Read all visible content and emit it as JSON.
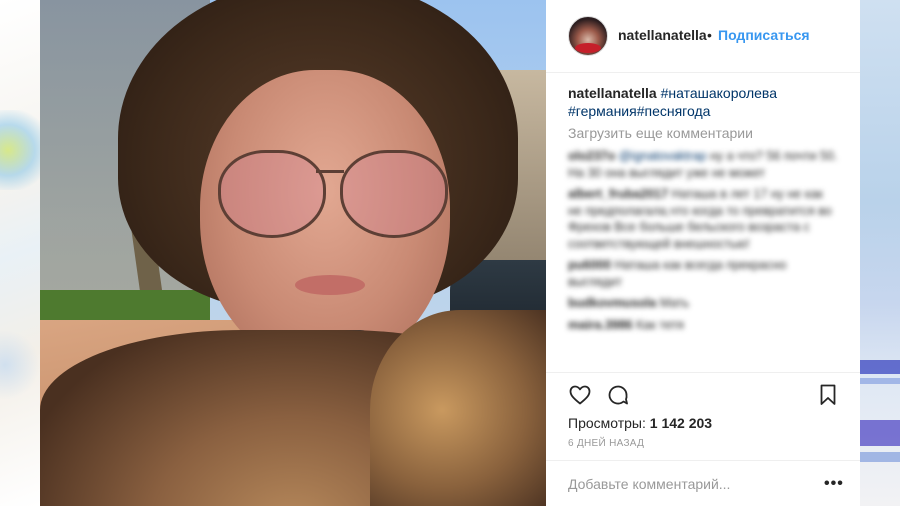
{
  "post": {
    "username": "natellanatella",
    "separator": "•",
    "follow_label": "Подписаться",
    "caption_user": "natellanatella",
    "caption_tags": [
      "#наташакоролева",
      "#германия#песнягода"
    ],
    "load_more": "Загрузить еще комментарии",
    "comments": [
      {
        "user": "olo237o",
        "mention": "@ignatovaktrap",
        "text": " ну а что? 56 почти 50. На 30 она выглядит уже не может"
      },
      {
        "user": "albert_fruba2017",
        "mention": "",
        "text": " Наташа в лет 17 ну не как не предполагала,что когда то превратится во Фрехов Все больше бельского возраста с соответствующей внешностью!"
      },
      {
        "user": "pu6000",
        "mention": "",
        "text": " Наташа как всегда прекрасно выглядит"
      },
      {
        "user": "budkovmusola",
        "mention": "",
        "text": " Мать"
      },
      {
        "user": "maira.3986",
        "mention": "",
        "text": " Как тетя"
      }
    ],
    "views_label": "Просмотры:",
    "views_count": "1 142 203",
    "date": "6 ДНЕЙ НАЗАД",
    "add_comment_placeholder": "Добавьте комментарий...",
    "more_options": "•••"
  },
  "icons": {
    "like": "heart-icon",
    "comment": "comment-icon",
    "save": "bookmark-icon",
    "more": "more-options-icon"
  },
  "colors": {
    "link_blue": "#3897f0",
    "hashtag": "#003569",
    "muted": "#999999",
    "text": "#262626"
  }
}
